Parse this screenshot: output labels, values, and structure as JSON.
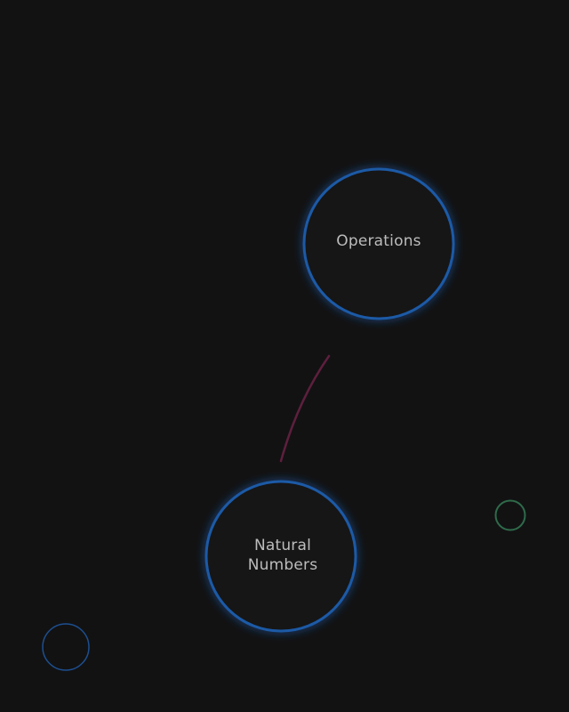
{
  "graph": {
    "nodes": [
      {
        "id": "operations",
        "label_lines": [
          "Operations"
        ],
        "style": "primary"
      },
      {
        "id": "natural-numbers",
        "label_lines": [
          "Natural",
          "Numbers"
        ],
        "style": "primary"
      },
      {
        "id": "unlabeled-green",
        "label_lines": [],
        "style": "minor-green"
      },
      {
        "id": "unlabeled-blue",
        "label_lines": [],
        "style": "minor-blue"
      }
    ],
    "edges": [
      {
        "from": "operations",
        "to": "natural-numbers"
      }
    ]
  },
  "colors": {
    "background": "#121213",
    "primary_ring": "#1f5aa6",
    "primary_glow": "#1e5fb4",
    "minor_green_ring": "#2f6b4a",
    "minor_blue_ring": "#1d4f8f",
    "edge": "#5e1f3d",
    "label": "#bcbcbc"
  }
}
